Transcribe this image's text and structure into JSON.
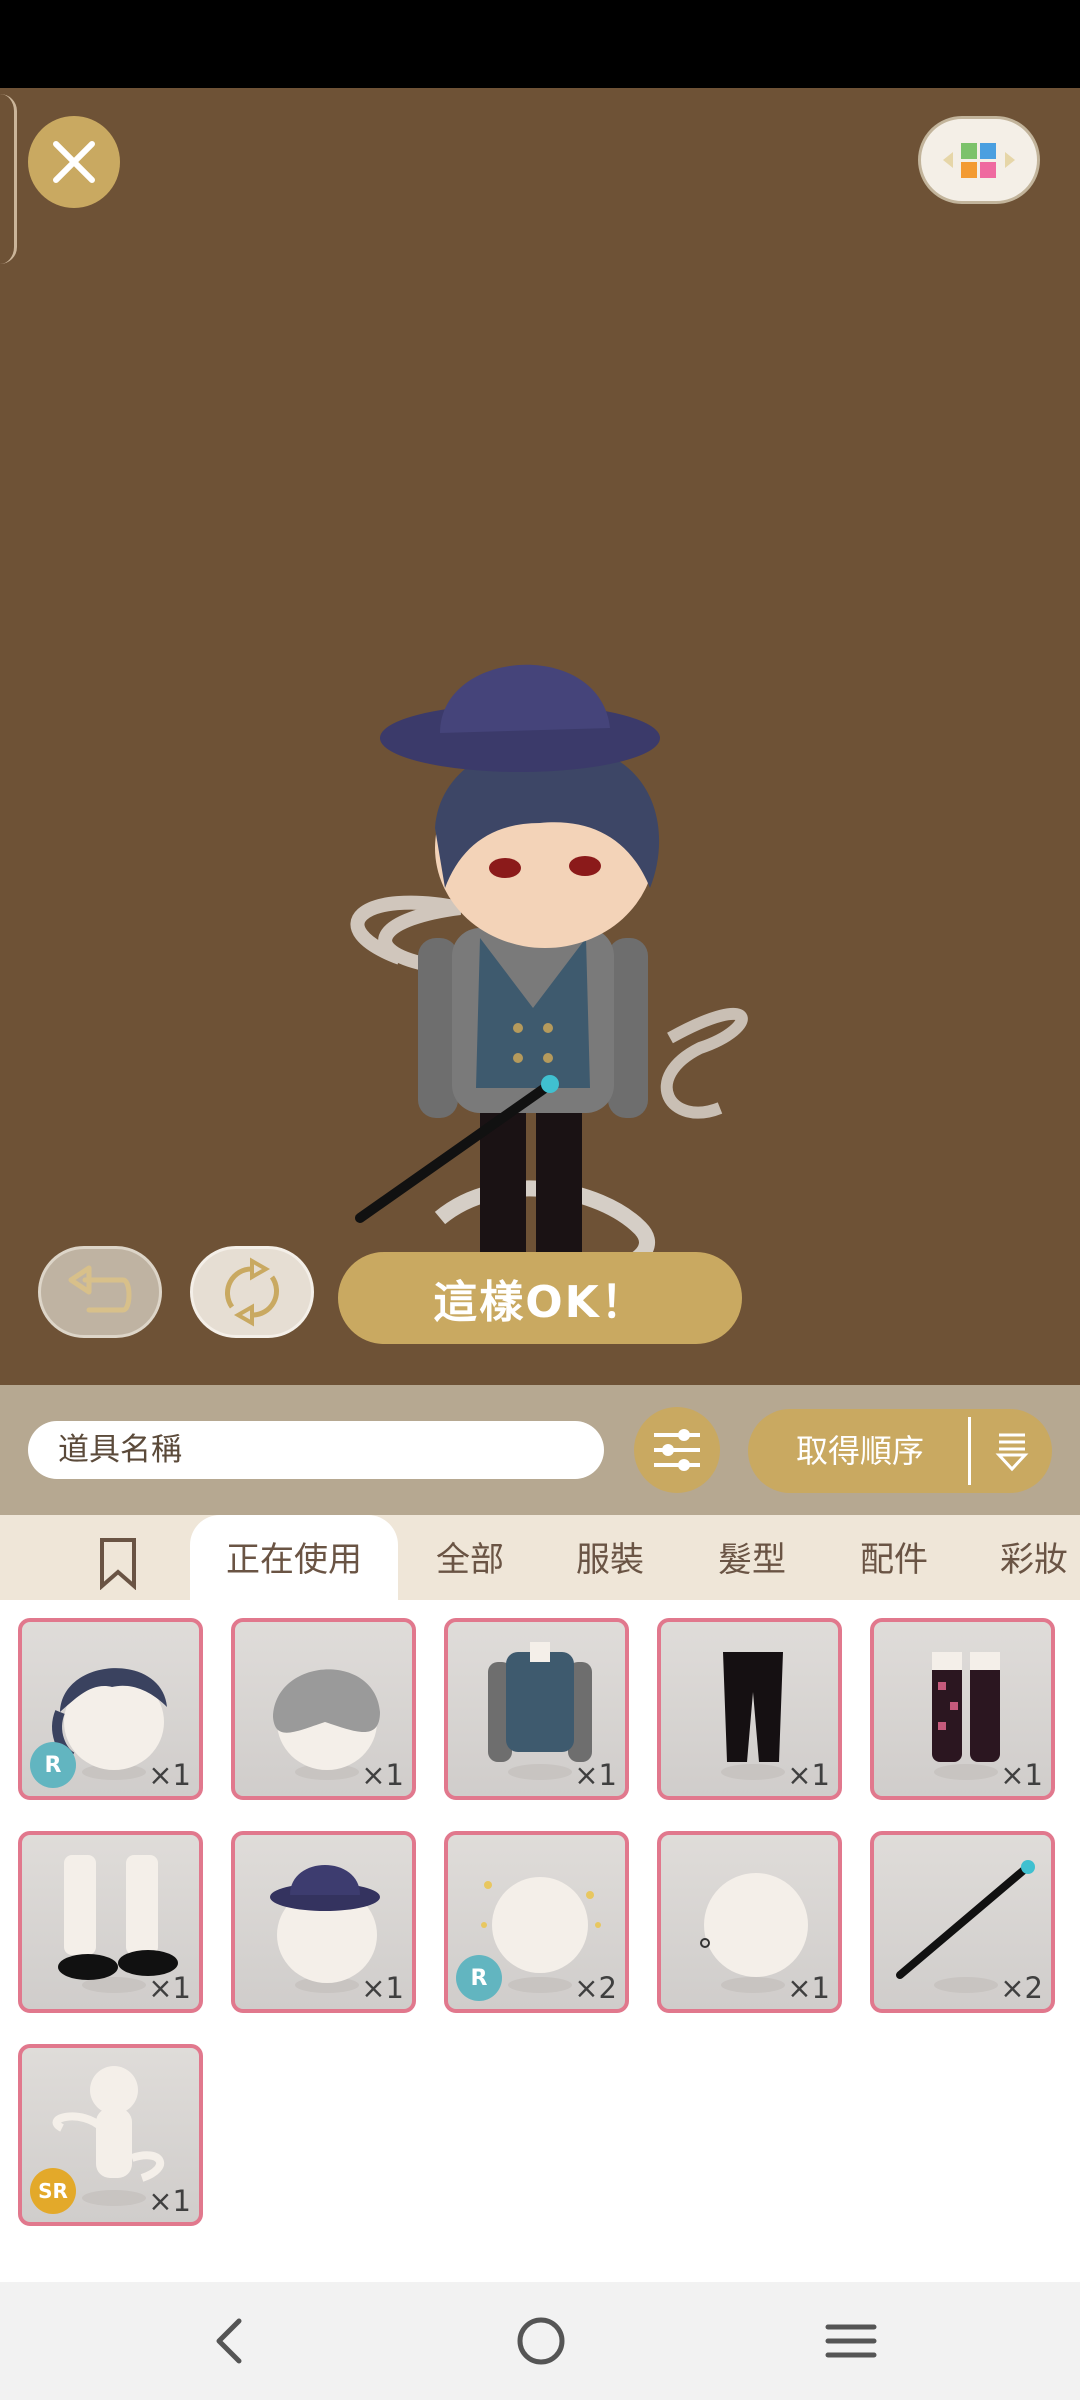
{
  "stage": {
    "ok_label": "這樣OK！"
  },
  "filter": {
    "search_placeholder": "道具名稱",
    "sort_label": "取得順序"
  },
  "tabs": [
    {
      "label": "正在使用",
      "active": true
    },
    {
      "label": "全部"
    },
    {
      "label": "服裝"
    },
    {
      "label": "髮型"
    },
    {
      "label": "配件"
    },
    {
      "label": "彩妝"
    }
  ],
  "items": [
    {
      "name": "dark wavy hair",
      "qty": "×1",
      "rarity": "R"
    },
    {
      "name": "grey hair back",
      "qty": "×1"
    },
    {
      "name": "grey shirt with blue vest",
      "qty": "×1"
    },
    {
      "name": "black trousers",
      "qty": "×1"
    },
    {
      "name": "black and pink socks",
      "qty": "×1"
    },
    {
      "name": "black monk shoes",
      "qty": "×1"
    },
    {
      "name": "navy fedora hat",
      "qty": "×1"
    },
    {
      "name": "sparkle effect",
      "qty": "×2",
      "rarity": "R"
    },
    {
      "name": "earring",
      "qty": "×1"
    },
    {
      "name": "black cane",
      "qty": "×2"
    },
    {
      "name": "smoke aura",
      "qty": "×1",
      "rarity": "SR"
    }
  ],
  "icons": {
    "close": "close-icon",
    "palette": "palette-grid-icon",
    "undo": "undo-icon",
    "random": "shuffle-icon",
    "filter": "filter-sliders-icon",
    "sort": "sort-order-icon",
    "bookmark": "bookmark-icon",
    "nav_back": "back-icon",
    "nav_home": "home-icon",
    "nav_menu": "menu-icon"
  },
  "colors": {
    "stage_bg": "#6e5236",
    "gold": "#c9a961",
    "item_border": "#e1788d",
    "rarity_r": "#62b5c0",
    "rarity_sr": "#e3a92a"
  }
}
